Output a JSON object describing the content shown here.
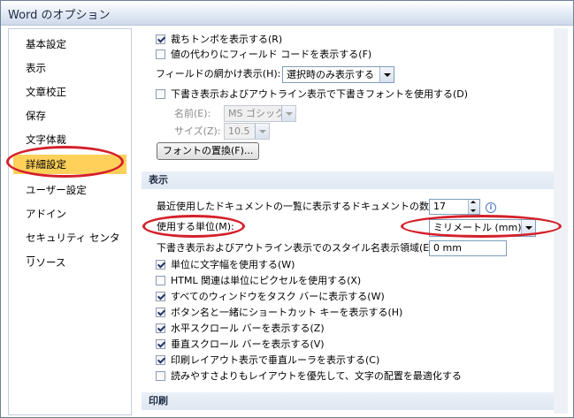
{
  "window": {
    "title": "Word のオプション"
  },
  "sidebar": {
    "items": [
      {
        "label": "基本設定"
      },
      {
        "label": "表示"
      },
      {
        "label": "文章校正"
      },
      {
        "label": "保存"
      },
      {
        "label": "文字体裁"
      },
      {
        "label": "詳細設定",
        "selected": true
      },
      {
        "label": "ユーザー設定"
      },
      {
        "label": "アドイン"
      },
      {
        "label": "セキュリティ センター"
      },
      {
        "label": "リソース"
      }
    ]
  },
  "top_options": {
    "crop_marks": {
      "label": "裁ちトンボを表示する(R)",
      "checked": true
    },
    "field_codes": {
      "label": "値の代わりにフィールド コードを表示する(F)",
      "checked": false
    },
    "field_shading": {
      "label": "フィールドの網かけ表示(H):",
      "value": "選択時のみ表示する"
    },
    "draft_font": {
      "label": "下書き表示およびアウトライン表示で下書きフォントを使用する(D)",
      "checked": false
    },
    "font_name": {
      "label": "名前(E):",
      "value": "MS ゴシック"
    },
    "font_size": {
      "label": "サイズ(Z):",
      "value": "10.5"
    },
    "font_substitution_button": "フォントの置換(F)..."
  },
  "display_section": {
    "header": "表示",
    "recent_docs": {
      "label": "最近使用したドキュメントの一覧に表示するドキュメントの数(R):",
      "value": "17",
      "info_icon": "i"
    },
    "units": {
      "label": "使用する単位(M):",
      "value": "ミリメートル (mm)"
    },
    "style_area": {
      "label": "下書き表示およびアウトライン表示でのスタイル名表示領域(E):",
      "value": "0 mm"
    },
    "checkboxes": [
      {
        "label": "単位に文字幅を使用する(W)",
        "checked": true
      },
      {
        "label": "HTML 関連は単位にピクセルを使用する(X)",
        "checked": false
      },
      {
        "label": "すべてのウィンドウをタスク バーに表示する(W)",
        "checked": true
      },
      {
        "label": "ボタン名と一緒にショートカット キーを表示する(H)",
        "checked": true
      },
      {
        "label": "水平スクロール バーを表示する(Z)",
        "checked": true
      },
      {
        "label": "垂直スクロール バーを表示する(V)",
        "checked": true
      },
      {
        "label": "印刷レイアウト表示で垂直ルーラを表示する(C)",
        "checked": true
      },
      {
        "label": "読みやすさよりもレイアウトを優先して、文字の配置を最適化する",
        "checked": false
      }
    ]
  },
  "print_section": {
    "header": "印刷"
  },
  "colors": {
    "highlight": "#ffd15a",
    "annotation": "#d4202a",
    "section_bg": "#dfe7f2"
  }
}
